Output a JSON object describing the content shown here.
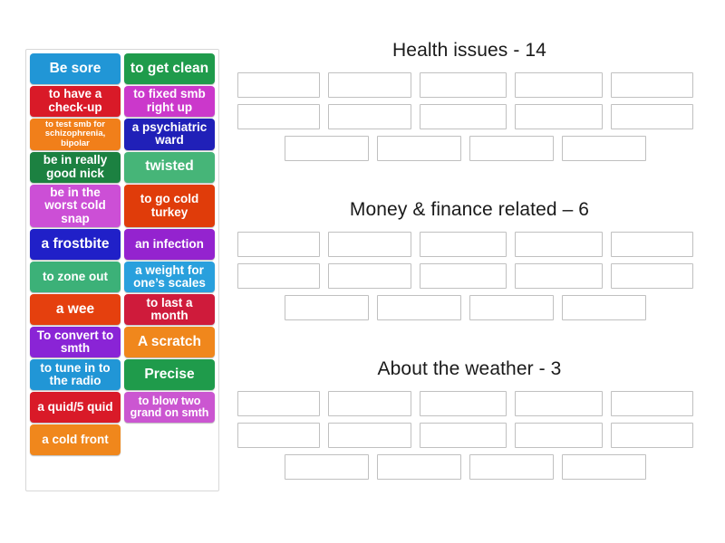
{
  "tile_panel": {
    "name": "word-tiles",
    "rows": [
      [
        {
          "label": "Be sore",
          "color": "#2196d6",
          "size": "fs-lg"
        },
        {
          "label": "to get clean",
          "color": "#1f9b4b",
          "size": "fs-lg"
        }
      ],
      [
        {
          "label": "to have a check-up",
          "color": "#d91a28",
          "size": "fs-md"
        },
        {
          "label": "to fixed smb right up",
          "color": "#cb38cb",
          "size": "fs-md"
        }
      ],
      [
        {
          "label": "to test smb for schizophrenia, bipolar",
          "color": "#f17f1a",
          "size": "fs-xs"
        },
        {
          "label": "a psychiatric ward",
          "color": "#2020b8",
          "size": "fs-md"
        }
      ],
      [
        {
          "label": "be in really good nick",
          "color": "#1c8141",
          "size": "fs-md"
        },
        {
          "label": "twisted",
          "color": "#46b578",
          "size": "fs-lg"
        }
      ],
      [
        {
          "label": "be in the worst cold snap",
          "color": "#cc4fd6",
          "size": "fs-md"
        },
        {
          "label": "to go cold turkey",
          "color": "#e03c0a",
          "size": "fs-md"
        }
      ],
      [
        {
          "label": "a frostbite",
          "color": "#2020c8",
          "size": "fs-lg"
        },
        {
          "label": "an infection",
          "color": "#9423cf",
          "size": "fs-md"
        }
      ],
      [
        {
          "label": "to zone out",
          "color": "#3cb178",
          "size": "fs-md"
        },
        {
          "label": "a weight for one’s scales",
          "color": "#29a0dd",
          "size": "fs-md"
        }
      ],
      [
        {
          "label": "a wee",
          "color": "#e5400e",
          "size": "fs-lg"
        },
        {
          "label": "to last a month",
          "color": "#cf1b3b",
          "size": "fs-md"
        }
      ],
      [
        {
          "label": "To convert to smth",
          "color": "#8a24d6",
          "size": "fs-md"
        },
        {
          "label": "A scratch",
          "color": "#f0871c",
          "size": "fs-lg"
        }
      ],
      [
        {
          "label": "to tune in to the radio",
          "color": "#2196d6",
          "size": "fs-md"
        },
        {
          "label": "Precise",
          "color": "#1f9b4b",
          "size": "fs-lg"
        }
      ],
      [
        {
          "label": "a quid/5 quid",
          "color": "#d91a28",
          "size": "fs-md"
        },
        {
          "label": "to blow two grand on smth",
          "color": "#cb56d1",
          "size": "fs-sm"
        }
      ],
      [
        {
          "label": "a cold front",
          "color": "#f0871c",
          "size": "fs-md"
        },
        {
          "label": "",
          "color": "transparent",
          "size": "fs-md",
          "empty": true
        }
      ]
    ]
  },
  "groups": [
    {
      "title": "Health issues - 14",
      "rows": [
        {
          "count": 5,
          "offset": false
        },
        {
          "count": 5,
          "offset": false
        },
        {
          "count": 4,
          "offset": true
        }
      ]
    },
    {
      "title": "Money & finance related – 6",
      "rows": [
        {
          "count": 5,
          "offset": false
        },
        {
          "count": 5,
          "offset": false
        },
        {
          "count": 4,
          "offset": true
        }
      ]
    },
    {
      "title": "About the weather - 3",
      "rows": [
        {
          "count": 5,
          "offset": false
        },
        {
          "count": 5,
          "offset": false
        },
        {
          "count": 4,
          "offset": true
        }
      ]
    }
  ]
}
